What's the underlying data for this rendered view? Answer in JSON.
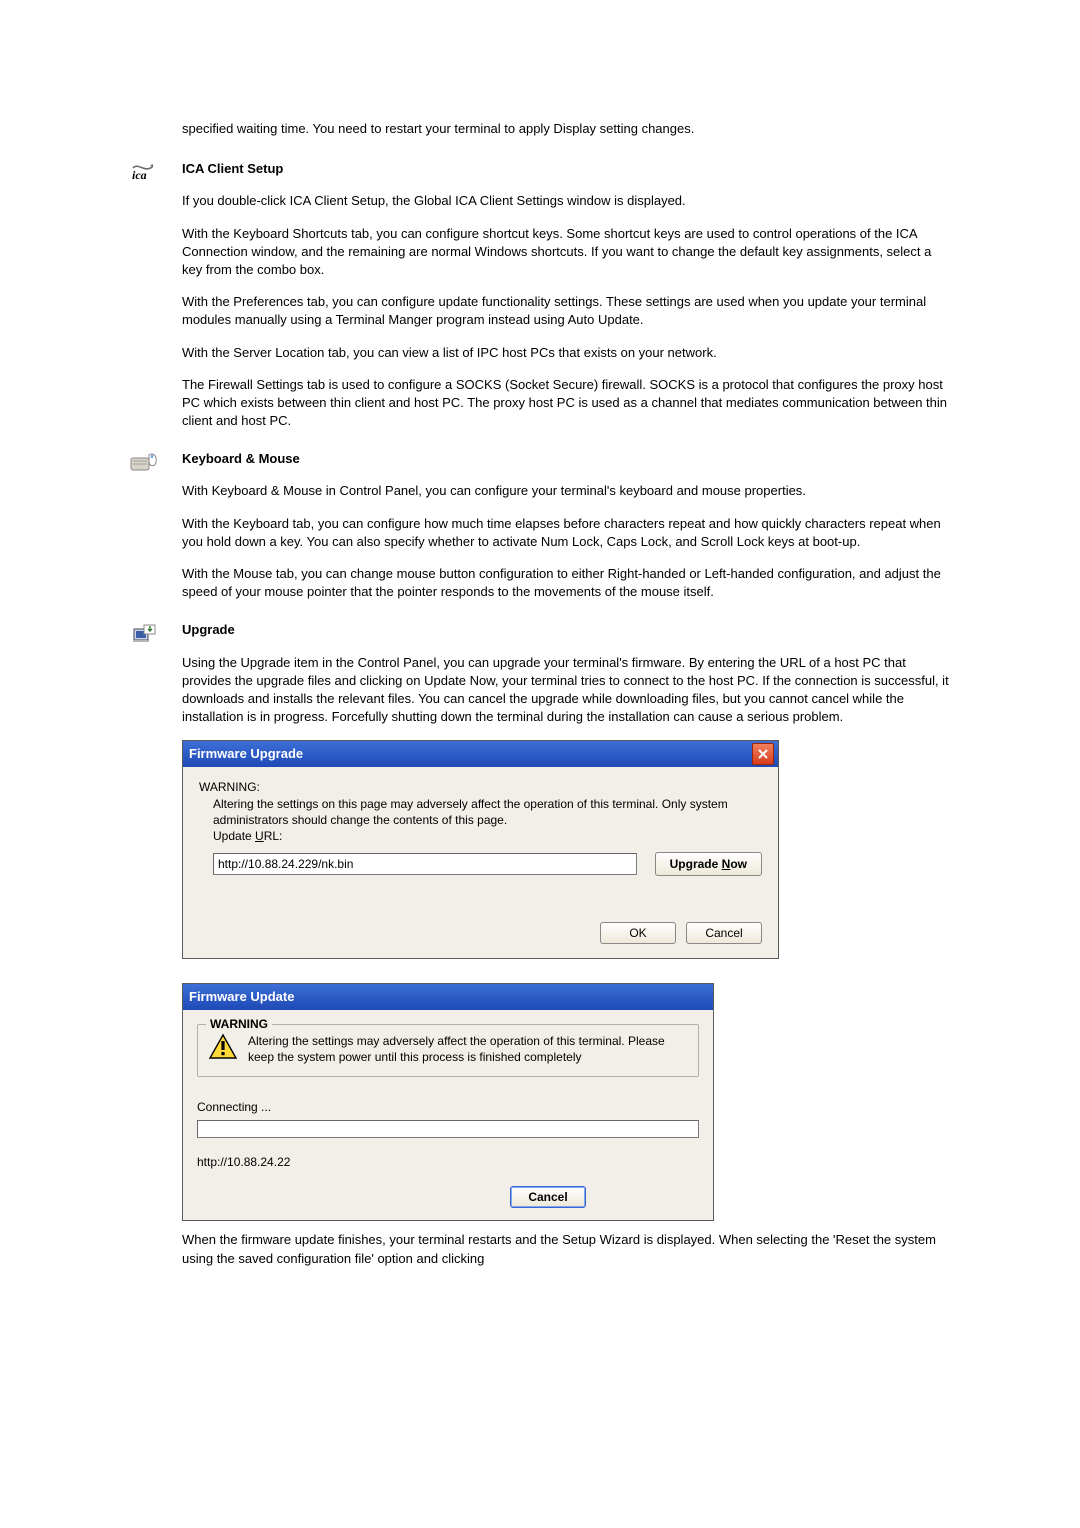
{
  "intro": {
    "waiting_time": "specified waiting time. You need to restart your terminal to apply Display setting changes."
  },
  "ica": {
    "title": "ICA Client Setup",
    "p1": "If you double-click ICA Client Setup, the Global ICA Client Settings window is displayed.",
    "p2": "With the Keyboard Shortcuts tab, you can configure shortcut keys. Some shortcut keys are used to control operations of the ICA Connection window, and the remaining are normal Windows shortcuts. If you want to change the default key assignments, select a key from the combo box.",
    "p3": "With the Preferences tab, you can configure update functionality settings. These settings are used when you update your terminal modules manually using a Terminal Manger program instead using Auto Update.",
    "p4": "With the Server Location tab, you can view a list of IPC host PCs that exists on your network.",
    "p5": "The Firewall Settings tab is used to configure a SOCKS (Socket Secure) firewall. SOCKS is a protocol that configures the proxy host PC which exists between thin client and host PC. The proxy host PC is used as a channel that mediates communication between thin client and host PC."
  },
  "km": {
    "title": "Keyboard & Mouse",
    "p1": "With Keyboard & Mouse in Control Panel, you can configure your terminal's keyboard and mouse properties.",
    "p2": "With the Keyboard tab, you can configure how much time elapses before characters repeat and how quickly characters repeat when you hold down a key. You can also specify whether to activate Num Lock, Caps Lock, and Scroll Lock keys at boot-up.",
    "p3": "With the Mouse tab, you can change mouse button configuration to either Right-handed or Left-handed configuration, and adjust the speed of your mouse pointer that the pointer responds to the movements of the mouse itself."
  },
  "upgrade": {
    "title": "Upgrade",
    "p1": "Using the Upgrade item in the Control Panel, you can upgrade your terminal's firmware. By entering the URL of a host PC that provides the upgrade files and clicking on Update Now, your terminal tries to connect to the host PC. If the connection is successful, it downloads and installs the relevant files. You can cancel the upgrade while downloading files, but you cannot cancel while the installation is in progress. Forcefully shutting down the terminal during the installation can cause a serious problem."
  },
  "dlg_upgrade": {
    "title": "Firmware Upgrade",
    "warning_label": "WARNING:",
    "warning_text": "Altering the settings on this page may adversely affect the operation of this terminal.  Only system administrators should change the contents of this page.",
    "url_label_pre": "Update ",
    "url_label_u": "U",
    "url_label_post": "RL:",
    "url_value": "http://10.88.24.229/nk.bin",
    "btn_upgrade_pre": "Upgrade ",
    "btn_upgrade_u": "N",
    "btn_upgrade_post": "ow",
    "btn_ok": "OK",
    "btn_cancel": "Cancel"
  },
  "dlg_update": {
    "title": "Firmware Update",
    "group_label": "WARNING",
    "warning_text": "Altering the settings may adversely affect the operation of this terminal. Please keep the system power until this process is finished completely",
    "connecting": "Connecting ...",
    "addr": "http://10.88.24.22",
    "btn_cancel": "Cancel"
  },
  "footer": {
    "p1": "When the firmware update finishes, your terminal restarts and the Setup Wizard is displayed. When selecting the 'Reset the system using the saved configuration file' option and clicking"
  }
}
